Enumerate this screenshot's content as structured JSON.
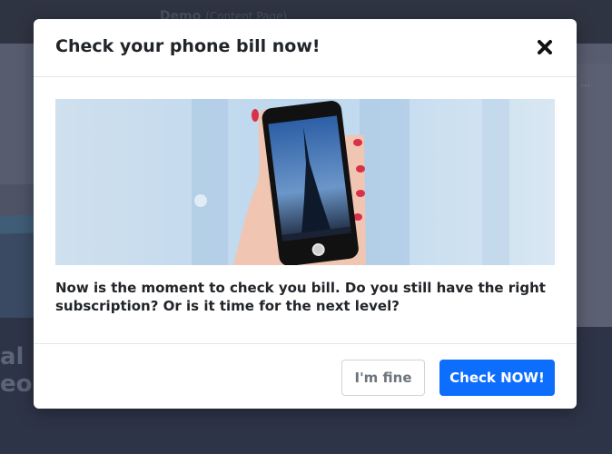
{
  "background": {
    "nav_title": "Demo",
    "nav_subtitle": "(Content Page)",
    "headline_line1": "al in",
    "headline_line2": "eop",
    "side_card_text": "..."
  },
  "modal": {
    "title": "Check your phone bill now!",
    "close_icon": "close-icon",
    "image_description_icon": "phone-photo",
    "body_text": "Now is the moment to check you bill. Do you still have the right subscription? Or is it time for the next level?",
    "buttons": {
      "secondary_label": "I'm fine",
      "primary_label": "Check NOW!"
    }
  },
  "colors": {
    "primary": "#0d6efd",
    "overlay": "#3a4052"
  }
}
